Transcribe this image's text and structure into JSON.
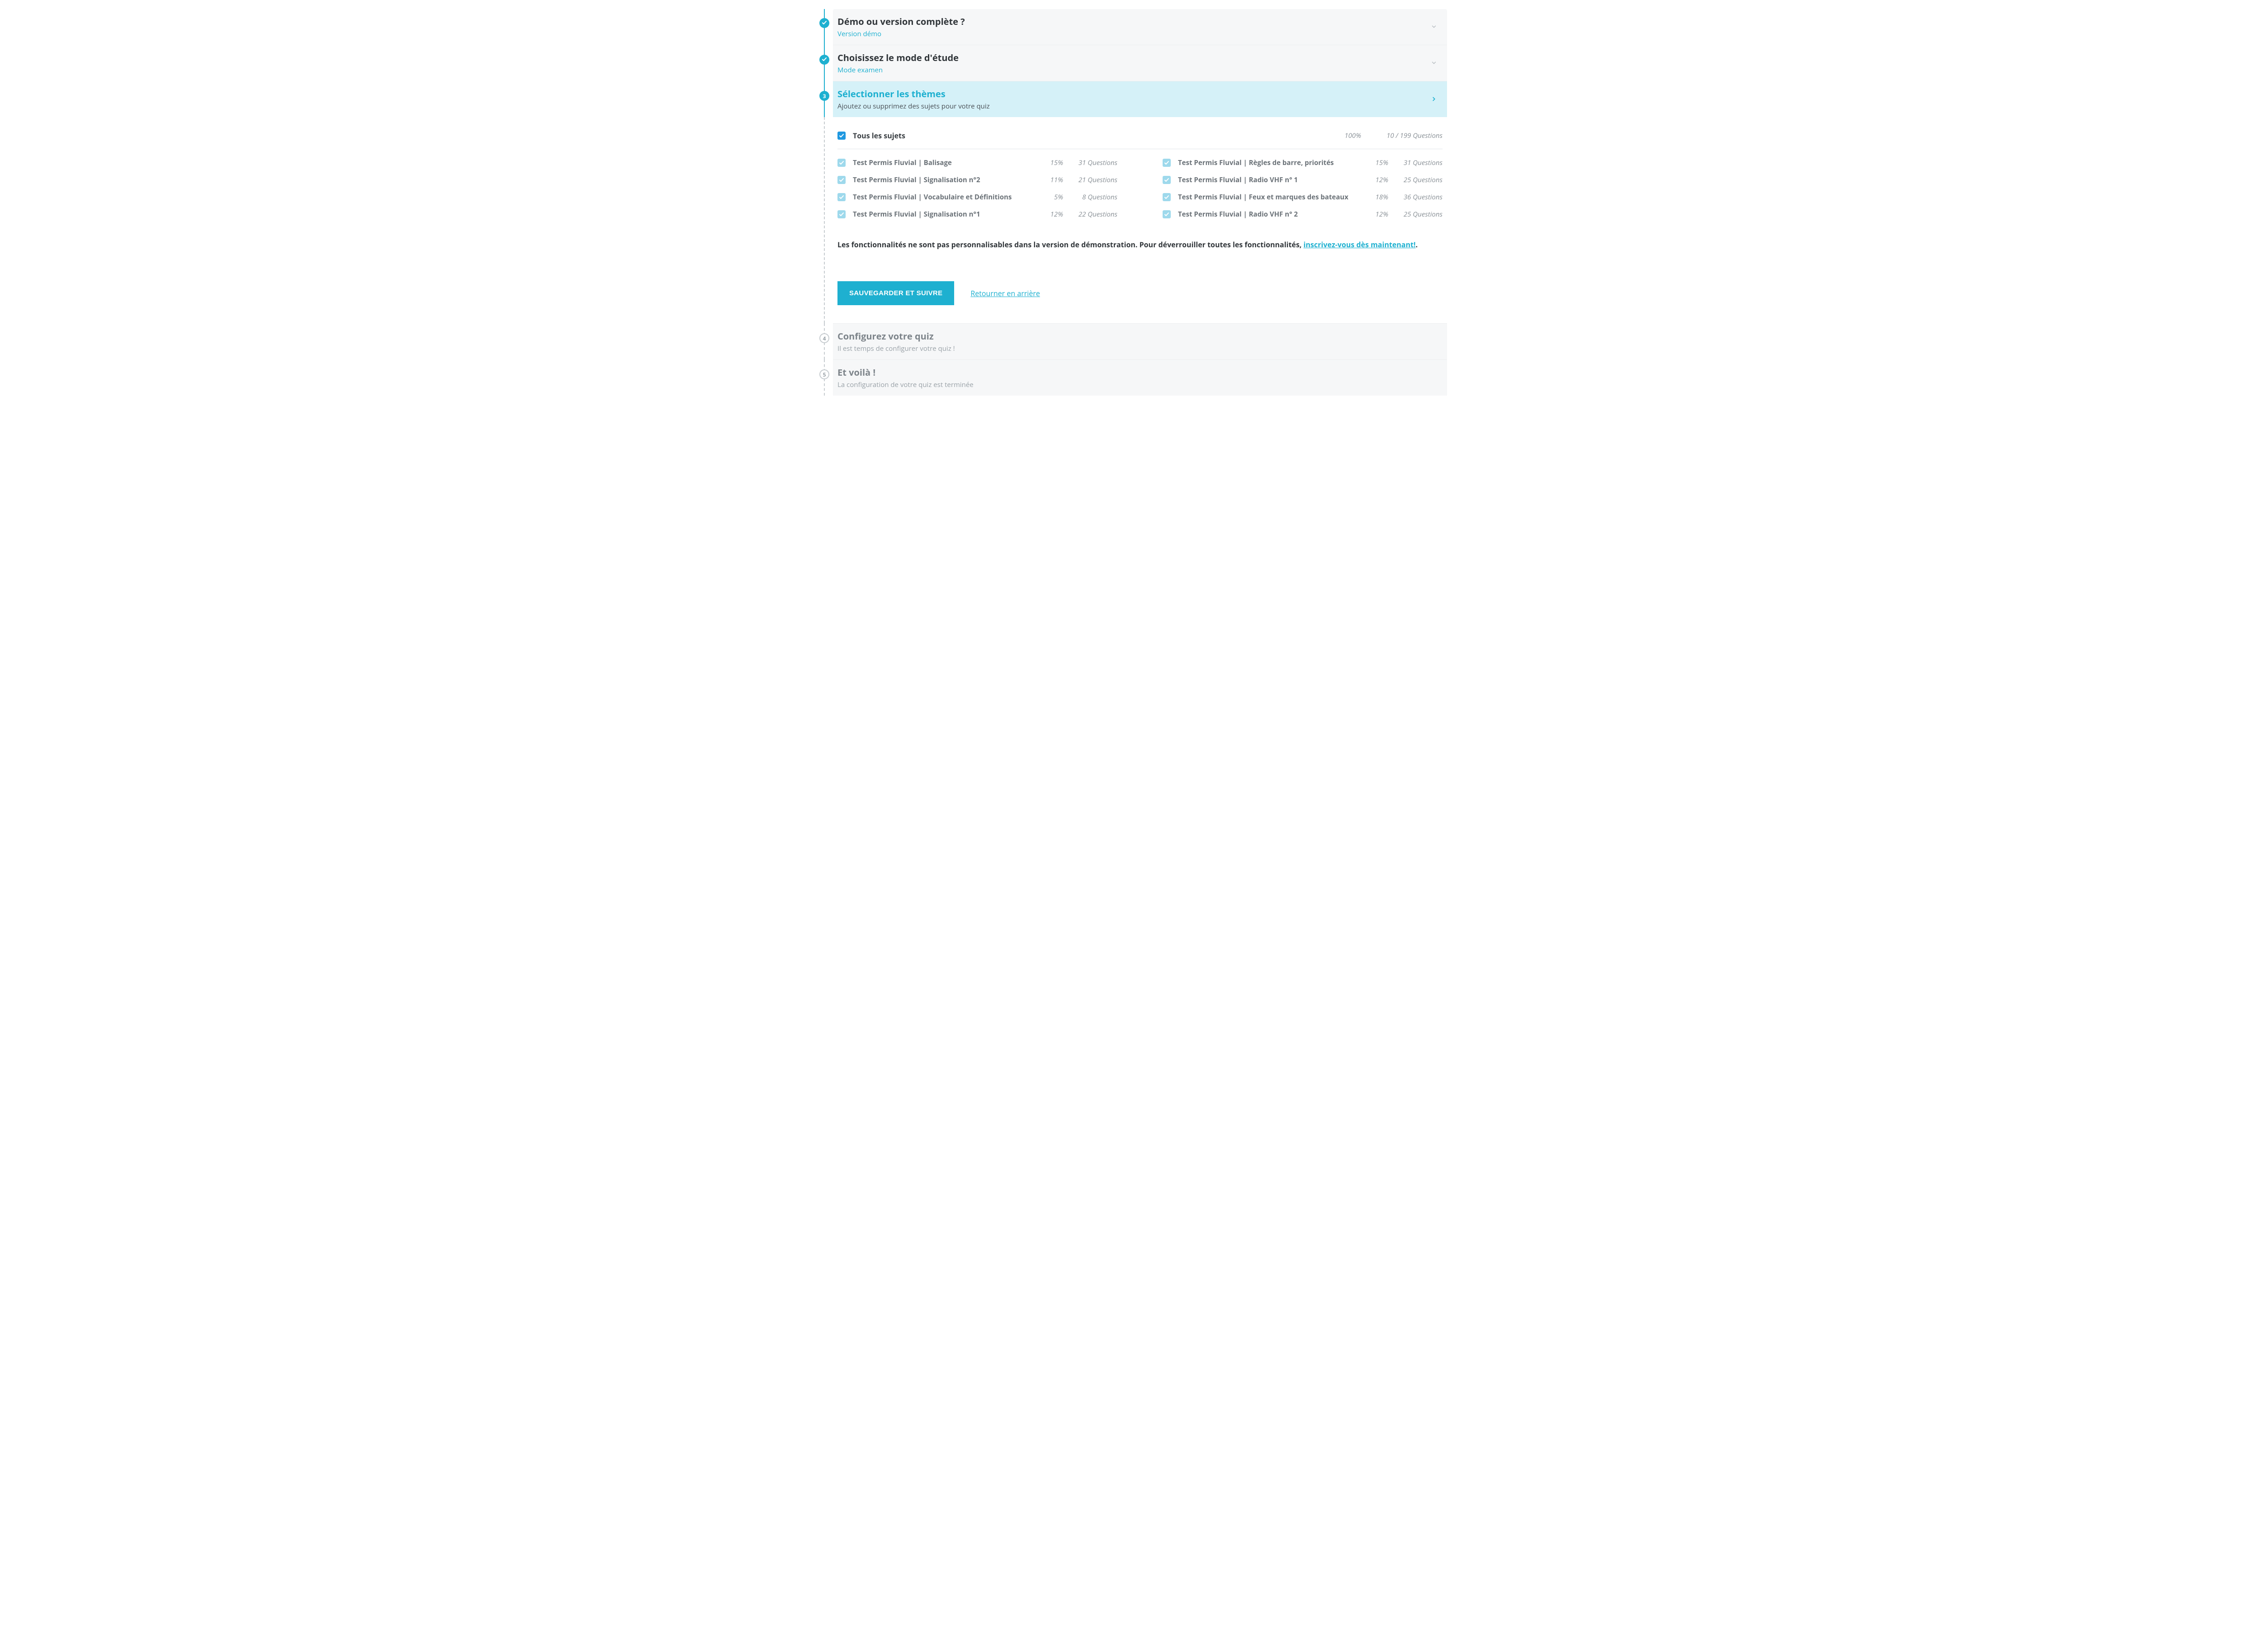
{
  "steps": {
    "s1": {
      "title": "Démo ou version complète ?",
      "value": "Version démo"
    },
    "s2": {
      "title": "Choisissez le mode d'étude",
      "value": "Mode examen"
    },
    "s3": {
      "num": "3",
      "title": "Sélectionner les thèmes",
      "sub": "Ajoutez ou supprimez des sujets pour votre quiz"
    },
    "s4": {
      "num": "4",
      "title": "Configurez votre quiz",
      "sub": "Il est temps de configurer votre quiz !"
    },
    "s5": {
      "num": "5",
      "title": "Et voilà !",
      "sub": "La configuration de votre quiz est terminée"
    }
  },
  "all_subjects": {
    "label": "Tous les sujets",
    "pct": "100%",
    "qs": "10 / 199 Questions"
  },
  "topics_left": [
    {
      "label": "Test Permis Fluvial | Balisage",
      "pct": "15%",
      "qs": "31 Questions"
    },
    {
      "label": "Test Permis Fluvial | Signalisation n°2",
      "pct": "11%",
      "qs": "21 Questions"
    },
    {
      "label": "Test Permis Fluvial | Vocabulaire et Définitions",
      "pct": "5%",
      "qs": "8 Questions"
    },
    {
      "label": "Test Permis Fluvial | Signalisation n°1",
      "pct": "12%",
      "qs": "22 Questions"
    }
  ],
  "topics_right": [
    {
      "label": "Test Permis Fluvial | Règles de barre, priorités",
      "pct": "15%",
      "qs": "31 Questions"
    },
    {
      "label": "Test Permis Fluvial | Radio VHF n° 1",
      "pct": "12%",
      "qs": "25 Questions"
    },
    {
      "label": "Test Permis Fluvial | Feux et marques des bateaux",
      "pct": "18%",
      "qs": "36 Questions"
    },
    {
      "label": "Test Permis Fluvial | Radio VHF n° 2",
      "pct": "12%",
      "qs": "25 Questions"
    }
  ],
  "notice": {
    "prefix": "Les fonctionnalités ne sont pas personnalisables dans la version de démonstration. Pour déverrouiller toutes les fonctionnalités, ",
    "link": "inscrivez-vous dès maintenant!",
    "suffix": "."
  },
  "actions": {
    "save": "SAUVEGARDER ET SUIVRE",
    "back": "Retourner en arrière"
  }
}
